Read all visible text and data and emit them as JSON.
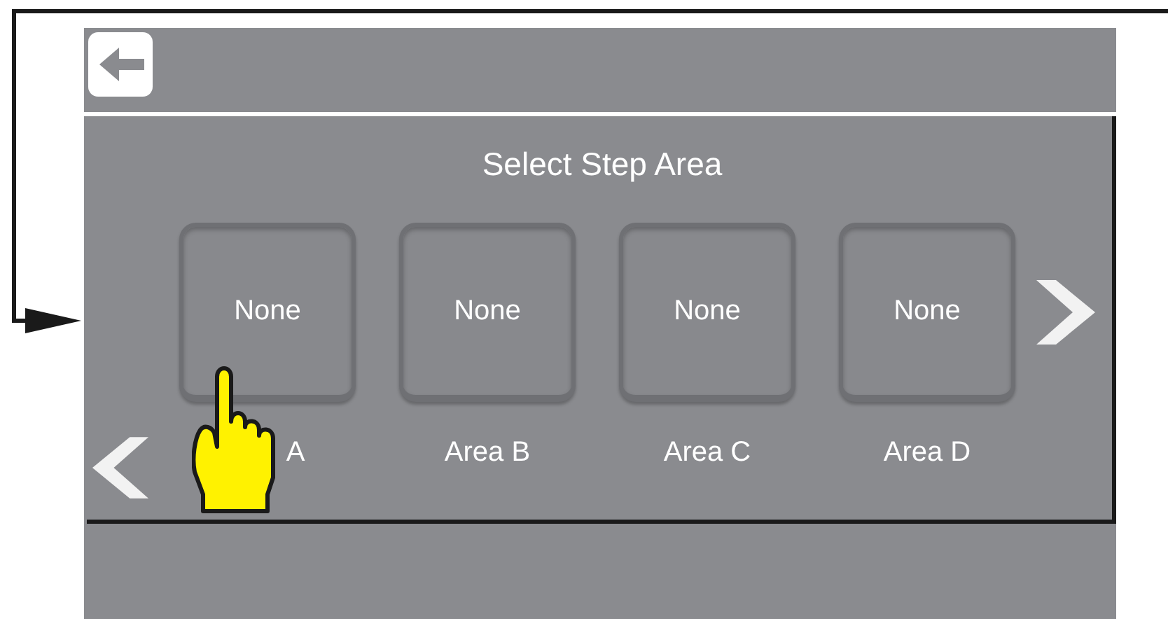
{
  "screen": {
    "title": "Select Step Area",
    "areas": [
      {
        "value": "None",
        "label": "A"
      },
      {
        "value": "None",
        "label": "Area B"
      },
      {
        "value": "None",
        "label": "Area C"
      },
      {
        "value": "None",
        "label": "Area D"
      }
    ]
  }
}
